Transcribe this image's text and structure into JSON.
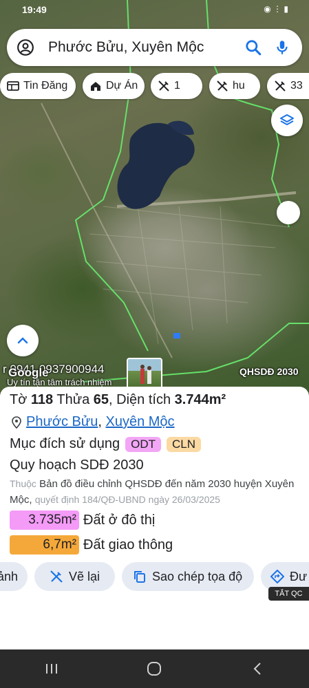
{
  "status_bar": {
    "time": "19:49",
    "right": "◉ ⋮ ▮"
  },
  "search": {
    "query": "Phước Bửu, Xuyên Mộc",
    "left_icon": "account-circle-icon",
    "search_icon": "search-icon",
    "mic_icon": "microphone-icon"
  },
  "chips": [
    {
      "label": "Tin Đăng",
      "icon": "listing-icon"
    },
    {
      "label": "Dự Án",
      "icon": "house-project-icon"
    },
    {
      "label": "1",
      "icon": "no-edit-icon"
    },
    {
      "label": "hu",
      "icon": "no-edit-icon"
    },
    {
      "label": "33",
      "icon": "no-edit-icon"
    }
  ],
  "map": {
    "phone_overlay": "r 0941 0937900944",
    "slogan_overlay": "Uy tín tận tâm trách nhiệm",
    "google_logo": "Google",
    "layer_label": "QHSDĐ 2030",
    "layers_icon": "layers-icon",
    "expand_icon": "chevron-up-icon"
  },
  "parcel": {
    "to_label": "Tờ",
    "to_value": "118",
    "thua_label": "Thửa",
    "thua_value": "65",
    "area_label": "Diện tích",
    "area_value": "3.744m²",
    "ward": "Phước Bửu",
    "district": "Xuyên Mộc",
    "purpose_label": "Mục đích sử dụng",
    "purpose_codes": [
      {
        "code": "ODT",
        "color": "#f3a6f5"
      },
      {
        "code": "CLN",
        "color": "#fbd9a3"
      }
    ],
    "plan_title": "Quy hoạch SDĐ 2030",
    "note_prefix": "Thuộc",
    "note_main": "Bản đồ điều chỉnh QHSDĐ đến năm 2030 huyện Xuyên Mộc,",
    "note_decision": "quyết định 184/QĐ-UBND ngày 26/03/2025",
    "areas": [
      {
        "value": "3.735m²",
        "label": "Đất ở đô thị",
        "color": "#f49af7"
      },
      {
        "value": "6,7m²",
        "label": "Đất giao thông",
        "color": "#f5a83a"
      }
    ]
  },
  "actions": [
    {
      "label": "ảnh",
      "icon": ""
    },
    {
      "label": "Vẽ lại",
      "icon": "redraw-icon"
    },
    {
      "label": "Sao chép tọa độ",
      "icon": "copy-icon"
    },
    {
      "label": "Đư",
      "icon": "directions-icon"
    }
  ],
  "ad_tag": "TẮT QC",
  "nav": [
    "recents-icon",
    "home-icon",
    "back-icon"
  ]
}
